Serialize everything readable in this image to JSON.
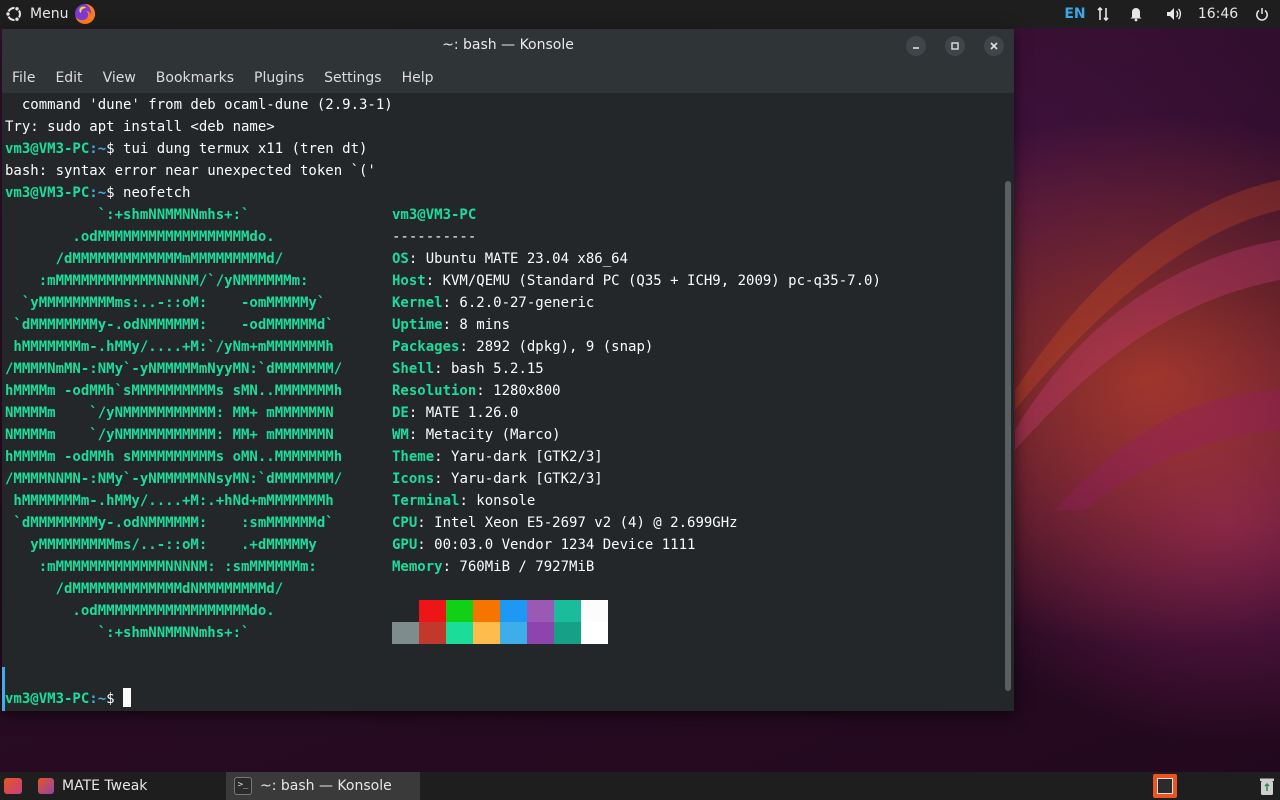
{
  "top_panel": {
    "menu_label": "Menu",
    "keyboard_layout": "EN",
    "clock": "16:46"
  },
  "window": {
    "title": "~: bash — Konsole",
    "menu": [
      "File",
      "Edit",
      "View",
      "Bookmarks",
      "Plugins",
      "Settings",
      "Help"
    ]
  },
  "terminal": {
    "prompt_host": "vm3@VM3-PC",
    "prompt_path": ":~",
    "prompt_symbol": "$",
    "lines": {
      "l1": "  command 'dune' from deb ocaml-dune (2.9.3-1)",
      "l2": "Try: sudo apt install <deb name>",
      "l3_cmd": " tui dung termux x11 (tren dt)",
      "l4": "bash: syntax error near unexpected token `('",
      "l5_cmd": " neofetch",
      "final_cmd": " "
    },
    "ascii": [
      "           `:+shmNNMMNNmhs+:`",
      "        .odMMMMMMMMMMMMMMMMMMdo.",
      "      /dMMMMMMMMMMMMMmMMMMMMMMMd/",
      "    :mMMMMMMMMMMMMNNNNM/`/yNMMMMMMm:",
      "  `yMMMMMMMMMms:..-::oM:    -omMMMMMy`",
      " `dMMMMMMMMy-.odNMMMMMM:    -odMMMMMMd`",
      " hMMMMMMMm-.hMMy/....+M:`/yNm+mMMMMMMMh",
      "/MMMMNmMN-:NMy`-yNMMMMMmNyyMN:`dMMMMMMM/",
      "hMMMMm -odMMh`sMMMMMMMMMMs sMN..MMMMMMMh",
      "NMMMMm    `/yNMMMMMMMMMMM: MM+ mMMMMMMN",
      "NMMMMm    `/yNMMMMMMMMMMM: MM+ mMMMMMMN",
      "hMMMMm -odMMh sMMMMMMMMMMs oMN..MMMMMMMh",
      "/MMMMNNMN-:NMy`-yNMMMMMNNsyMN:`dMMMMMMM/",
      " hMMMMMMMm-.hMMy/....+M:.+hNd+mMMMMMMMh",
      " `dMMMMMMMMy-.odNMMMMMM:    :smMMMMMMd`",
      "   yMMMMMMMMMms/..-::oM:    .+dMMMMMy",
      "    :mMMMMMMMMMMMMMNNNNM: :smMMMMMMm:",
      "      /dMMMMMMMMMMMMMdNMMMMMMMMd/",
      "        .odMMMMMMMMMMMMMMMMMMdo.",
      "           `:+shmNNMMNNmhs+:`"
    ],
    "info_title": "vm3@VM3-PC",
    "info_sep": "----------",
    "info": [
      {
        "key": "OS",
        "value": ": Ubuntu MATE 23.04 x86_64"
      },
      {
        "key": "Host",
        "value": ": KVM/QEMU (Standard PC (Q35 + ICH9, 2009) pc-q35-7.0)"
      },
      {
        "key": "Kernel",
        "value": ": 6.2.0-27-generic"
      },
      {
        "key": "Uptime",
        "value": ": 8 mins"
      },
      {
        "key": "Packages",
        "value": ": 2892 (dpkg), 9 (snap)"
      },
      {
        "key": "Shell",
        "value": ": bash 5.2.15"
      },
      {
        "key": "Resolution",
        "value": ": 1280x800"
      },
      {
        "key": "DE",
        "value": ": MATE 1.26.0"
      },
      {
        "key": "WM",
        "value": ": Metacity (Marco)"
      },
      {
        "key": "Theme",
        "value": ": Yaru-dark [GTK2/3]"
      },
      {
        "key": "Icons",
        "value": ": Yaru-dark [GTK2/3]"
      },
      {
        "key": "Terminal",
        "value": ": konsole"
      },
      {
        "key": "CPU",
        "value": ": Intel Xeon E5-2697 v2 (4) @ 2.699GHz"
      },
      {
        "key": "GPU",
        "value": ": 00:03.0 Vendor 1234 Device 1111"
      },
      {
        "key": "Memory",
        "value": ": 760MiB / 7927MiB"
      }
    ],
    "palette_row1": [
      "#232729",
      "#ed1515",
      "#11d116",
      "#f67400",
      "#1d99f3",
      "#9b59b6",
      "#1abc9c",
      "#fcfcfc"
    ],
    "palette_row2": [
      "#7f8c8d",
      "#c0392b",
      "#1cdc9a",
      "#fdbc4b",
      "#3daee9",
      "#8e44ad",
      "#16a085",
      "#ffffff"
    ]
  },
  "taskbar": {
    "items": [
      "MATE Tweak",
      "~: bash — Konsole"
    ]
  }
}
